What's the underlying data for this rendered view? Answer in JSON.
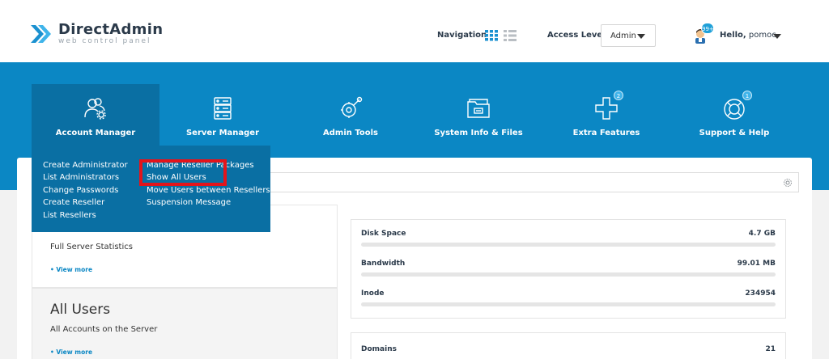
{
  "header": {
    "logo_name": "DirectAdmin",
    "logo_sub": "web control panel",
    "navigation_label": "Navigation",
    "access_level_label": "Access Level",
    "access_level_value": "Admin",
    "notification_count": "99+",
    "hello_label": "Hello,",
    "username": "pomoc"
  },
  "menu": {
    "items": [
      {
        "label": "Account Manager",
        "icon": "users-gear-icon"
      },
      {
        "label": "Server Manager",
        "icon": "server-icon"
      },
      {
        "label": "Admin Tools",
        "icon": "tools-icon"
      },
      {
        "label": "System Info & Files",
        "icon": "folder-icon"
      },
      {
        "label": "Extra Features",
        "icon": "plus-icon",
        "badge": "2"
      },
      {
        "label": "Support & Help",
        "icon": "lifebuoy-icon",
        "badge": "1"
      }
    ]
  },
  "dropdown": {
    "col1": [
      "Create Administrator",
      "List Administrators",
      "Change Passwords",
      "Create Reseller",
      "List Resellers"
    ],
    "col2_partial_top": "Manage Reseller Packages",
    "col2_highlighted": "Show All Users",
    "col2_partial_third": "Move Users between Resellers",
    "col2_last": "Suspension Message"
  },
  "main": {
    "panel1_subtitle": "Full Server Statistics",
    "panel1_view_more": "• View more",
    "panel2_title": "All Users",
    "panel2_subtitle": "All Accounts on the Server",
    "panel2_view_more": "• View more"
  },
  "stats": [
    {
      "name": "Disk Space",
      "value": "4.7 GB"
    },
    {
      "name": "Bandwidth",
      "value": "99.01 MB"
    },
    {
      "name": "Inode",
      "value": "234954"
    }
  ],
  "stats2": [
    {
      "name": "Domains",
      "value": "21"
    }
  ],
  "colors": {
    "band": "#0b87c4",
    "menu_active": "#0a6fa3",
    "highlight": "#e3141b"
  }
}
